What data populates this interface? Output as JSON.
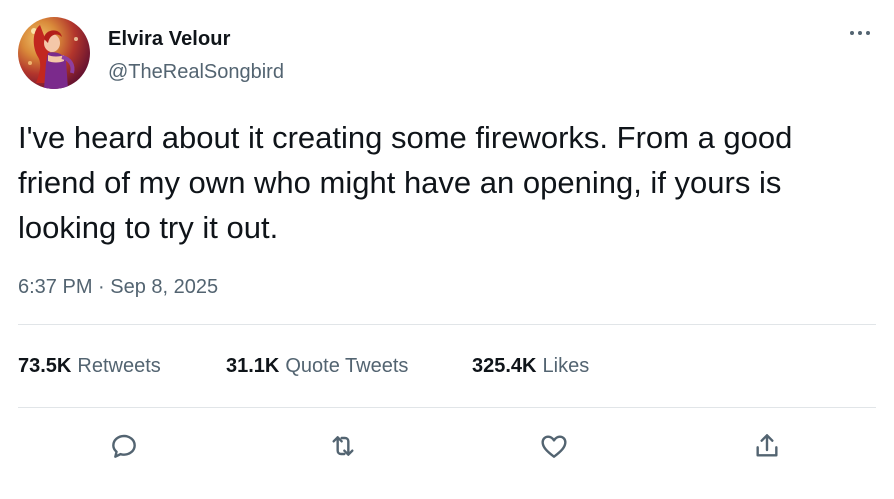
{
  "author": {
    "display_name": "Elvira Velour",
    "handle": "@TheRealSongbird"
  },
  "tweet": {
    "text": "I've heard about it creating some fireworks. From a good friend of my own who might have an opening, if yours is looking to try it out.",
    "timestamp": "6:37 PM · Sep 8, 2025"
  },
  "stats": {
    "retweets": {
      "count": "73.5K",
      "label": "Retweets"
    },
    "quote_tweets": {
      "count": "31.1K",
      "label": "Quote Tweets"
    },
    "likes": {
      "count": "325.4K",
      "label": "Likes"
    }
  },
  "actions": {
    "reply_icon": "reply-icon",
    "retweet_icon": "retweet-icon",
    "like_icon": "heart-icon",
    "share_icon": "share-icon",
    "more_icon": "more-icon"
  },
  "colors": {
    "text_primary": "#0f1419",
    "text_secondary": "#536471",
    "divider": "#e1e5e8"
  }
}
